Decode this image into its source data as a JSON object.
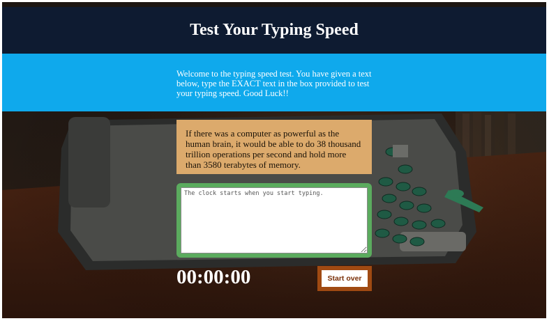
{
  "header": {
    "title": "Test Your Typing Speed"
  },
  "intro": {
    "text": "Welcome to the typing speed test. You have given a text below, type the EXACT text in the box provided to test your typing speed. Good Luck!!"
  },
  "origin_text": {
    "text": "If there was a computer as powerful as the human brain, it would be able to do 38 thousand trillion operations per second and hold more than 3580 terabytes of memory."
  },
  "test_area": {
    "value": "",
    "placeholder": "The clock starts when you start typing."
  },
  "timer": {
    "value": "00:00:00"
  },
  "reset_button": {
    "label": "Start over"
  },
  "colors": {
    "header_bg": "#0e1b31",
    "intro_bg": "#0fa9ec",
    "origin_bg": "#dcaa6c",
    "test_border": "#5bab5e",
    "reset_border": "#a04a12"
  },
  "background": {
    "icon": "typewriter-photo"
  }
}
